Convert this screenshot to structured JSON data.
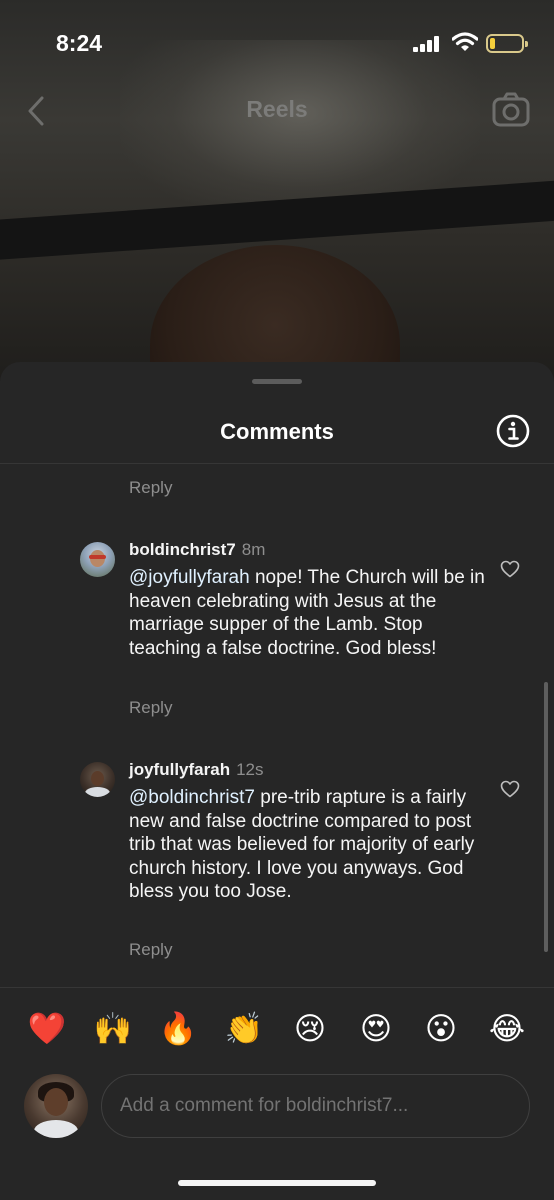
{
  "status_bar": {
    "time": "8:24",
    "battery_level": 0.15,
    "battery_color": "#f5cf3c"
  },
  "reels_header": {
    "title": "Reels",
    "back_icon": "chevron-left-icon",
    "camera_icon": "camera-icon"
  },
  "sheet": {
    "title": "Comments",
    "info_icon": "info-icon",
    "top_reply_label": "Reply"
  },
  "comments": [
    {
      "username": "boldinchrist7",
      "time": "8m",
      "mention": "@joyfullyfarah",
      "text": " nope! The Church will be in heaven celebrating with Jesus at the marriage supper of the Lamb. Stop teaching a false doctrine. God bless!",
      "reply_label": "Reply"
    },
    {
      "username": "joyfullyfarah",
      "time": "12s",
      "mention": "@boldinchrist7",
      "text": " pre-trib rapture is a fairly new and false doctrine compared to post trib that was believed for majority of early church history. I love you anyways. God bless you too Jose.",
      "reply_label": "Reply"
    }
  ],
  "emoji_reactions": [
    "❤️",
    "🙌",
    "🔥",
    "👏",
    "😢",
    "😍",
    "😮",
    "😂"
  ],
  "composer": {
    "placeholder": "Add a comment for boldinchrist7..."
  },
  "colors": {
    "sheet_background": "#262626",
    "secondary_text": "#8e8e8e",
    "mention": "#e0f1ff"
  }
}
